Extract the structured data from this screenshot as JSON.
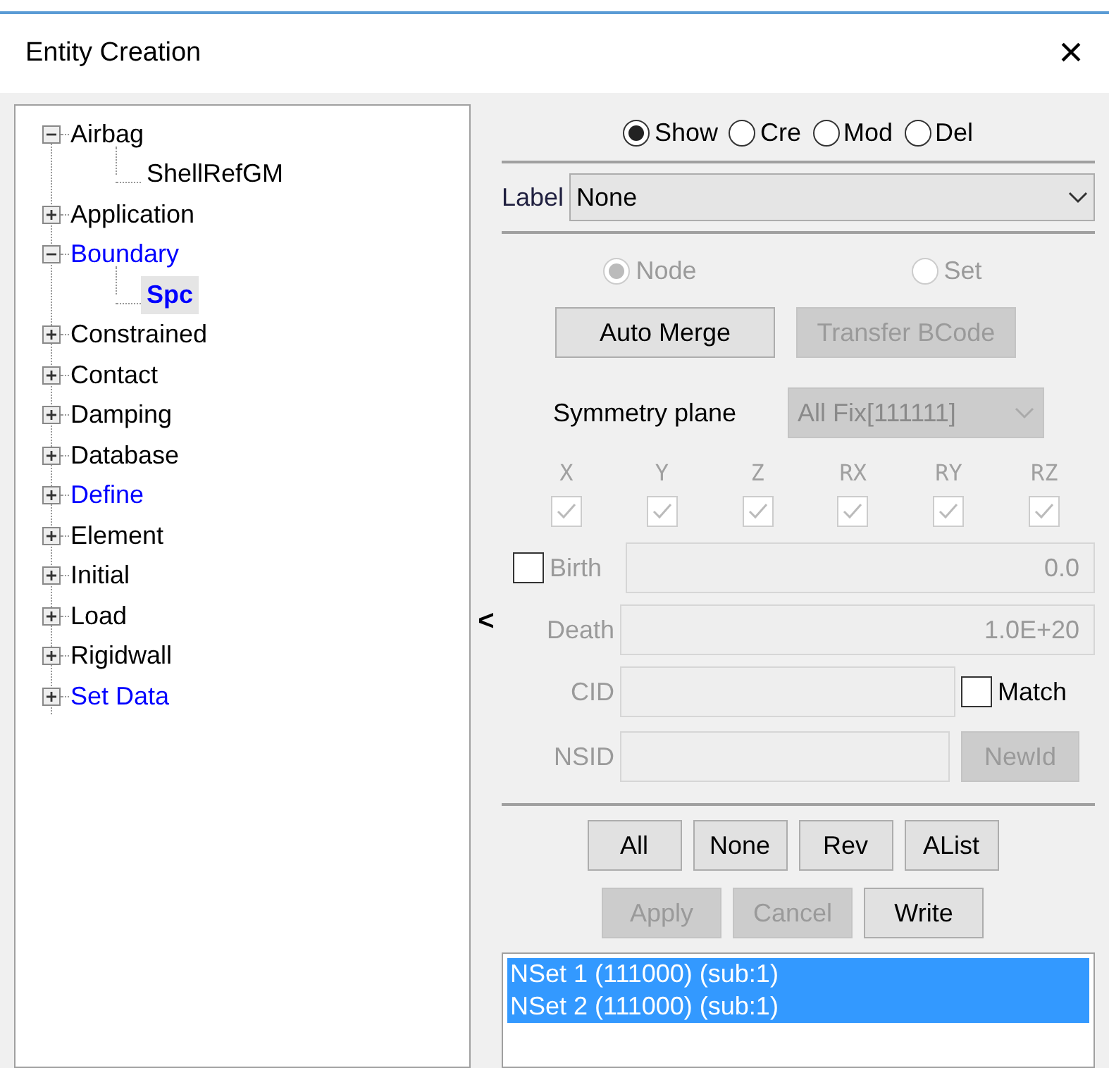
{
  "window": {
    "title": "Entity Creation",
    "close": "×"
  },
  "tree": [
    {
      "label": "Airbag",
      "expanded": true,
      "color": "#000000",
      "selected": false,
      "children": [
        {
          "label": "ShellRefGM",
          "color": "#000000",
          "selected": false
        }
      ]
    },
    {
      "label": "Application",
      "expanded": false,
      "color": "#000000",
      "selected": false
    },
    {
      "label": "Boundary",
      "expanded": true,
      "color": "#0000ff",
      "selected": false,
      "children": [
        {
          "label": "Spc",
          "color": "#0000ff",
          "selected": true
        }
      ]
    },
    {
      "label": "Constrained",
      "expanded": false,
      "color": "#000000",
      "selected": false
    },
    {
      "label": "Contact",
      "expanded": false,
      "color": "#000000",
      "selected": false
    },
    {
      "label": "Damping",
      "expanded": false,
      "color": "#000000",
      "selected": false
    },
    {
      "label": "Database",
      "expanded": false,
      "color": "#000000",
      "selected": false
    },
    {
      "label": "Define",
      "expanded": false,
      "color": "#0000ff",
      "selected": false
    },
    {
      "label": "Element",
      "expanded": false,
      "color": "#000000",
      "selected": false
    },
    {
      "label": "Initial",
      "expanded": false,
      "color": "#000000",
      "selected": false
    },
    {
      "label": "Load",
      "expanded": false,
      "color": "#000000",
      "selected": false
    },
    {
      "label": "Rigidwall",
      "expanded": false,
      "color": "#000000",
      "selected": false
    },
    {
      "label": "Set Data",
      "expanded": false,
      "color": "#0000ff",
      "selected": false
    }
  ],
  "collapse_handle": "<",
  "modes": [
    {
      "label": "Show",
      "selected": true
    },
    {
      "label": "Cre",
      "selected": false
    },
    {
      "label": "Mod",
      "selected": false
    },
    {
      "label": "Del",
      "selected": false
    }
  ],
  "label_select": {
    "label": "Label",
    "value": "None"
  },
  "target": [
    {
      "label": "Node",
      "selected": true,
      "disabled": true
    },
    {
      "label": "Set",
      "selected": false,
      "disabled": true
    }
  ],
  "merge_buttons": [
    {
      "label": "Auto Merge",
      "disabled": false
    },
    {
      "label": "Transfer BCode",
      "disabled": true
    }
  ],
  "symmetry": {
    "label": "Symmetry plane",
    "value": "All Fix[111111]",
    "disabled": true
  },
  "dofs": [
    {
      "label": "X",
      "checked": true
    },
    {
      "label": "Y",
      "checked": true
    },
    {
      "label": "Z",
      "checked": true
    },
    {
      "label": "RX",
      "checked": true
    },
    {
      "label": "RY",
      "checked": true
    },
    {
      "label": "RZ",
      "checked": true
    }
  ],
  "birth": {
    "label": "Birth",
    "checked": false,
    "value": "0.0"
  },
  "death": {
    "label": "Death",
    "value": "1.0E+20"
  },
  "cid": {
    "label": "CID",
    "match_label": "Match",
    "match_checked": false
  },
  "nsid": {
    "label": "NSID",
    "button": "NewId"
  },
  "select_buttons": [
    {
      "label": "All",
      "disabled": false
    },
    {
      "label": "None",
      "disabled": false
    },
    {
      "label": "Rev",
      "disabled": false
    },
    {
      "label": "AList",
      "disabled": false
    }
  ],
  "action_buttons": [
    {
      "label": "Apply",
      "disabled": true
    },
    {
      "label": "Cancel",
      "disabled": true
    },
    {
      "label": "Write",
      "disabled": false
    }
  ],
  "sets": [
    {
      "label": "NSet 1 (111000) (sub:1)",
      "selected": true
    },
    {
      "label": "NSet 2 (111000) (sub:1)",
      "selected": true
    }
  ]
}
